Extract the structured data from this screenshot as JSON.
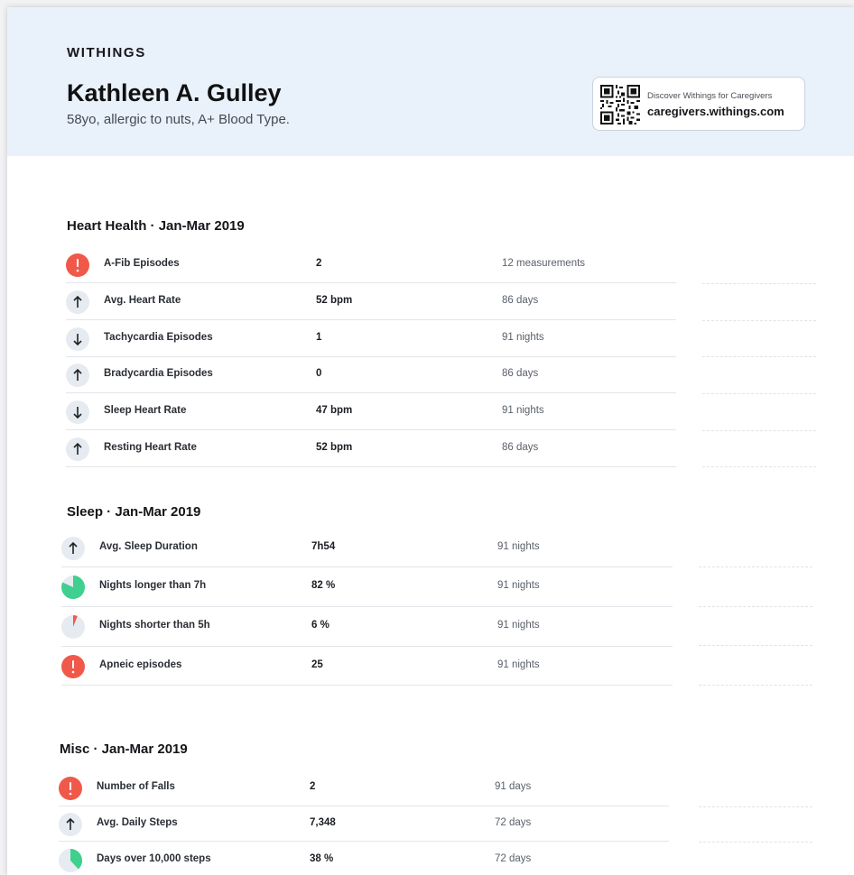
{
  "header": {
    "brand": "WITHINGS",
    "patient_name": "Kathleen A. Gulley",
    "patient_details": "58yo, allergic to nuts, A+ Blood Type.",
    "promo_text": "Discover Withings for Caregivers",
    "promo_url": "caregivers.withings.com"
  },
  "colors": {
    "alert_red": "#f0594a",
    "good_green": "#3fcf8e",
    "neutral_circle": "#e6ebf1",
    "header_bg": "#e9f1fb"
  },
  "heart": {
    "title": "Heart Health · Jan-Mar 2019",
    "rows": [
      {
        "icon": "alert-icon",
        "label": "A-Fib Episodes",
        "value": "2",
        "basis": "12 measurements"
      },
      {
        "icon": "arrow-up-icon",
        "label": "Avg. Heart Rate",
        "value": "52 bpm",
        "basis": "86 days"
      },
      {
        "icon": "arrow-down-icon",
        "label": "Tachycardia Episodes",
        "value": "1",
        "basis": "91 nights"
      },
      {
        "icon": "arrow-up-icon",
        "label": "Bradycardia Episodes",
        "value": "0",
        "basis": "86 days"
      },
      {
        "icon": "arrow-down-icon",
        "label": "Sleep Heart Rate",
        "value": "47 bpm",
        "basis": "91 nights"
      },
      {
        "icon": "arrow-up-icon",
        "label": "Resting Heart Rate",
        "value": "52 bpm",
        "basis": "86 days"
      }
    ]
  },
  "sleep": {
    "title": "Sleep · Jan-Mar 2019",
    "rows": [
      {
        "icon": "arrow-up-icon",
        "label": "Avg. Sleep Duration",
        "value": "7h54",
        "basis": "91 nights"
      },
      {
        "icon": "pie-chart-icon",
        "label": "Nights longer than 7h",
        "value": "82 %",
        "basis": "91 nights",
        "fraction": 0.82
      },
      {
        "icon": "pie-chart-icon",
        "label": "Nights shorter than 5h",
        "value": "6 %",
        "basis": "91 nights",
        "fraction": 0.06
      },
      {
        "icon": "alert-icon",
        "label": "Apneic episodes",
        "value": "25",
        "basis": "91 nights"
      }
    ]
  },
  "misc": {
    "title": "Misc · Jan-Mar 2019",
    "rows": [
      {
        "icon": "alert-icon",
        "label": "Number of Falls",
        "value": "2",
        "basis": "91 days"
      },
      {
        "icon": "arrow-up-icon",
        "label": "Avg. Daily Steps",
        "value": "7,348",
        "basis": "72 days"
      },
      {
        "icon": "pie-chart-icon",
        "label": "Days over 10,000 steps",
        "value": "38 %",
        "basis": "72 days",
        "fraction": 0.38
      }
    ]
  }
}
